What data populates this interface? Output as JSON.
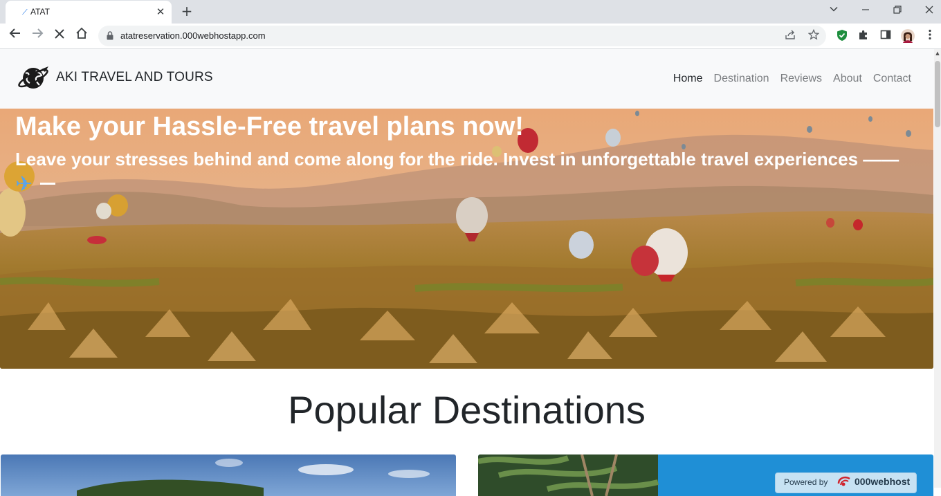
{
  "browser": {
    "tab_title": "ATAT",
    "tab_close": "✕",
    "new_tab": "+",
    "url": "atatreservation.000webhostapp.com",
    "minimize": "—",
    "restore": "❐",
    "close": "✕",
    "tab_search": "⌄"
  },
  "site": {
    "brand": "AKI TRAVEL AND TOURS",
    "nav": [
      "Home",
      "Destination",
      "Reviews",
      "About",
      "Contact"
    ],
    "active_nav": "Home",
    "hero_title": "Make your Hassle-Free travel plans now!",
    "hero_subtitle": "Leave your stresses behind and come along for the ride. Invest in unforgettable travel experiences ——",
    "section_title": "Popular Destinations",
    "badge_text": "Powered by",
    "badge_brand": "000webhost"
  },
  "colors": {
    "accent": "#1a73e8",
    "nav_bg": "#f8f9fa",
    "extension_green": "#1e8e3e"
  }
}
